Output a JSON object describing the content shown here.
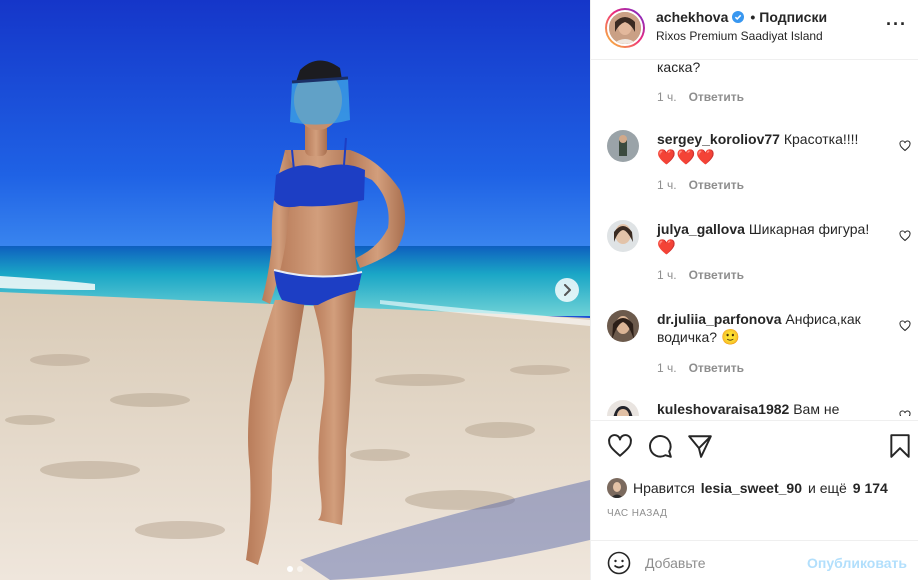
{
  "post": {
    "username": "achekhova",
    "follow_label": "Подписки",
    "separator": "•",
    "location": "Rixos Premium Saadiyat Island",
    "more_icon": "more-horizontal-icon"
  },
  "comments": [
    {
      "username": "",
      "text": "каска?",
      "time": "1 ч.",
      "reply": "Ответить"
    },
    {
      "username": "sergey_koroliov77",
      "text": "Красотка!!!!",
      "emoji": "❤️❤️❤️",
      "time": "1 ч.",
      "reply": "Ответить"
    },
    {
      "username": "julya_gallova",
      "text": "Шикарная фигура!",
      "emoji": "❤️",
      "time": "1 ч.",
      "reply": "Ответить"
    },
    {
      "username": "dr.juliia_parfonova",
      "text": "Анфиса,как водичка?",
      "emoji": "🙂",
      "time": "1 ч.",
      "reply": "Ответить"
    },
    {
      "username": "kuleshovaraisa1982",
      "text": "Вам не",
      "time": "",
      "reply": ""
    }
  ],
  "likes": {
    "prefix": "Нравится",
    "user": "lesia_sweet_90",
    "middle": "и ещё",
    "count": "9 174"
  },
  "timestamp": "ЧАС НАЗАД",
  "add_comment": {
    "placeholder": "Добавьте",
    "post_label": "Опубликовать"
  },
  "carousel": {
    "slides": 2,
    "active_index": 0
  },
  "colors": {
    "accent": "#0095f6",
    "post_disabled": "#b2dffc",
    "heart": "#e0161e",
    "verified": "#3897f0"
  }
}
